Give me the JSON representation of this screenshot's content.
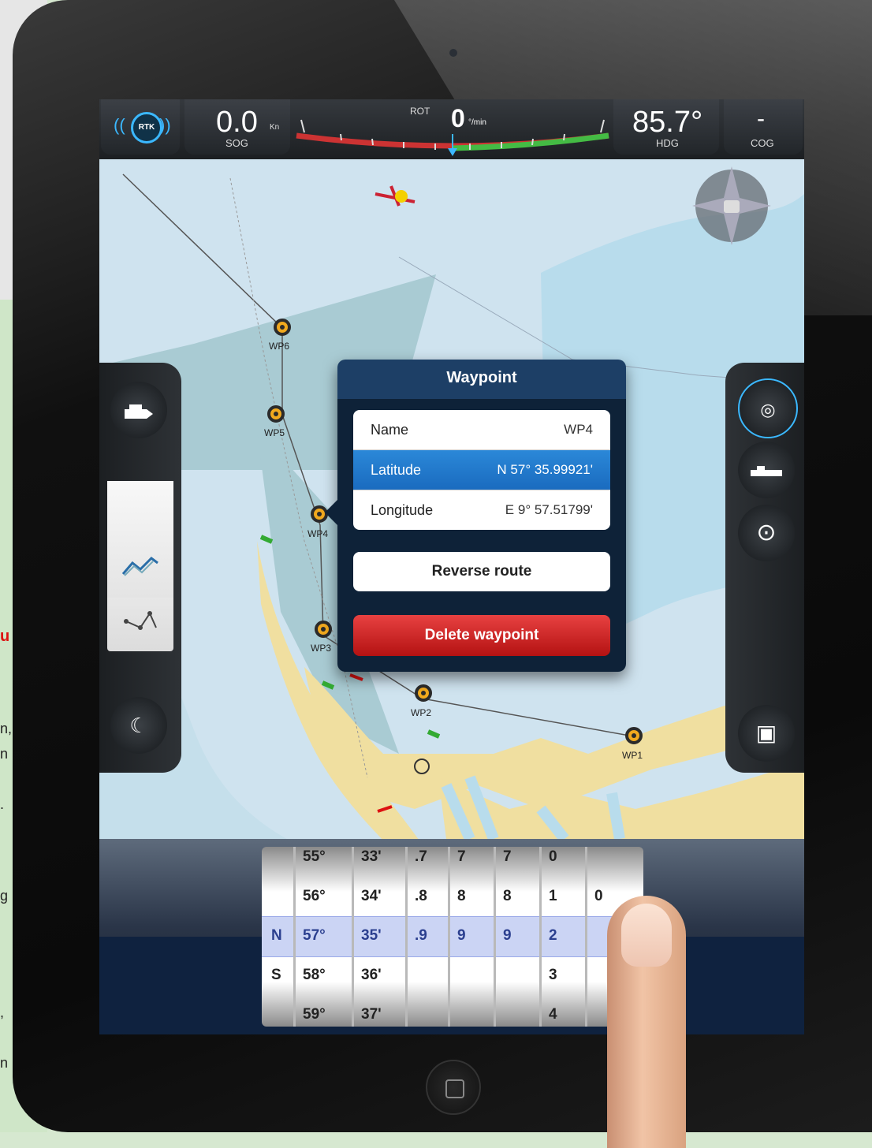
{
  "page_text": {
    "red_glyph": "u",
    "fragments": [
      "n,",
      "n",
      ".",
      "g",
      ",",
      "n"
    ]
  },
  "instruments": {
    "rtk_label": "RTK",
    "sog_value": "0.0",
    "sog_unit": "Kn",
    "sog_label": "SOG",
    "rot_label": "ROT",
    "rot_value": "0",
    "rot_unit": "°/min",
    "hdg_value": "85.7°",
    "hdg_label": "HDG",
    "cog_value": "-",
    "cog_label": "COG"
  },
  "waypoints": [
    {
      "label": "WP6"
    },
    {
      "label": "WP5"
    },
    {
      "label": "WP4"
    },
    {
      "label": "WP3"
    },
    {
      "label": "WP2"
    },
    {
      "label": "WP1"
    }
  ],
  "popover": {
    "title": "Waypoint",
    "fields": [
      {
        "label": "Name",
        "value": "WP4"
      },
      {
        "label": "Latitude",
        "value": "N 57° 35.99921'"
      },
      {
        "label": "Longitude",
        "value": "E 9° 57.51799'"
      }
    ],
    "reverse_label": "Reverse route",
    "delete_label": "Delete waypoint"
  },
  "picker": {
    "columns": [
      [
        "",
        "",
        "N",
        "S",
        ""
      ],
      [
        "55°",
        "56°",
        "57°",
        "58°",
        "59°"
      ],
      [
        "33'",
        "34'",
        "35'",
        "36'",
        "37'"
      ],
      [
        ".7",
        ".8",
        ".9",
        "",
        ""
      ],
      [
        "7",
        "8",
        "9",
        "",
        ""
      ],
      [
        "7",
        "8",
        "9",
        "",
        ""
      ],
      [
        "0",
        "1",
        "2",
        "3",
        "4"
      ],
      [
        "",
        "0",
        "",
        "",
        ""
      ]
    ]
  },
  "colors": {
    "accent": "#3bb8ff",
    "selected_row": "#1a6bbf",
    "delete": "#c41a1a",
    "water": "#cfe3ef",
    "land": "#f0dfa0",
    "waypoint": "#f1a91e"
  },
  "icons": {
    "left_panel": [
      "boat-icon",
      "chart-layers-icon",
      "route-icon",
      "day-night-icon"
    ],
    "right_panel": [
      "gps-position-icon",
      "ship-tools-icon",
      "radar-target-icon",
      "photo-gallery-icon"
    ]
  }
}
